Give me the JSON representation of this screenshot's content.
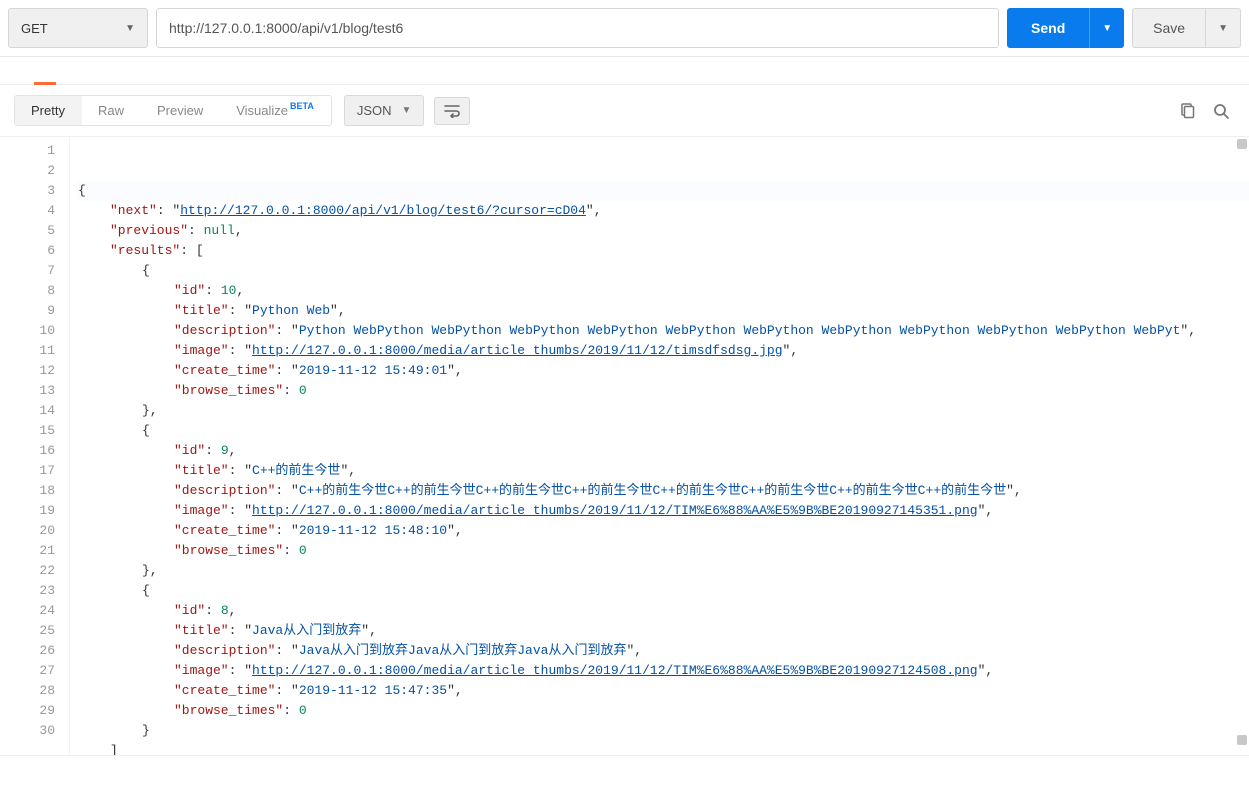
{
  "request": {
    "method": "GET",
    "url": "http://127.0.0.1:8000/api/v1/blog/test6"
  },
  "buttons": {
    "send": "Send",
    "save": "Save"
  },
  "response_tabs": {
    "pretty": "Pretty",
    "raw": "Raw",
    "preview": "Preview",
    "visualize": "Visualize",
    "beta": "BETA"
  },
  "format": "JSON",
  "line_count": 30,
  "json_body": {
    "next": "http://127.0.0.1:8000/api/v1/blog/test6/?cursor=cD04",
    "previous": null,
    "results": [
      {
        "id": 10,
        "title": "Python Web",
        "description": "Python WebPython WebPython WebPython WebPython WebPython WebPython WebPython WebPython WebPython WebPython WebPyt",
        "image": "http://127.0.0.1:8000/media/article_thumbs/2019/11/12/timsdfsdsg.jpg",
        "create_time": "2019-11-12 15:49:01",
        "browse_times": 0
      },
      {
        "id": 9,
        "title": "C++的前生今世",
        "description": "C++的前生今世C++的前生今世C++的前生今世C++的前生今世C++的前生今世C++的前生今世C++的前生今世C++的前生今世",
        "image": "http://127.0.0.1:8000/media/article_thumbs/2019/11/12/TIM%E6%88%AA%E5%9B%BE20190927145351.png",
        "create_time": "2019-11-12 15:48:10",
        "browse_times": 0
      },
      {
        "id": 8,
        "title": "Java从入门到放弃",
        "description": "Java从入门到放弃Java从入门到放弃Java从入门到放弃",
        "image": "http://127.0.0.1:8000/media/article_thumbs/2019/11/12/TIM%E6%88%AA%E5%9B%BE20190927124508.png",
        "create_time": "2019-11-12 15:47:35",
        "browse_times": 0
      }
    ]
  }
}
